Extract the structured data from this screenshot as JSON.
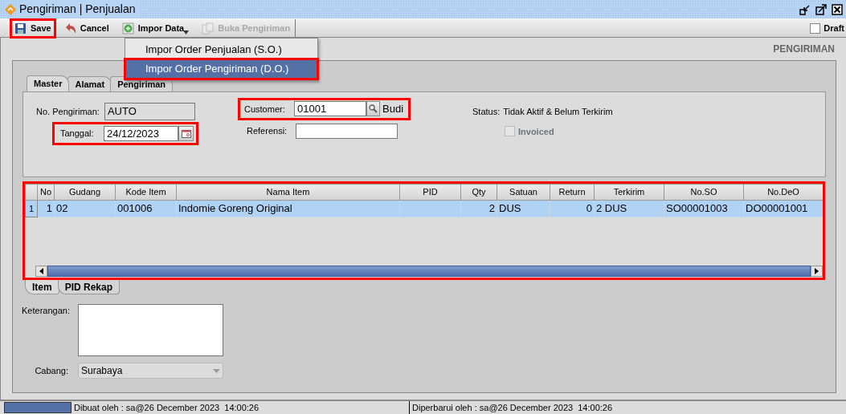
{
  "window": {
    "title": "Pengiriman | Penjualan"
  },
  "toolbar": {
    "buttons": [
      {
        "label": "Save",
        "kind": "save",
        "disabled": false,
        "highlighted": true
      },
      {
        "label": "Cancel",
        "kind": "cancel",
        "disabled": false,
        "highlighted": false
      },
      {
        "label": "Impor Data",
        "kind": "import",
        "disabled": false,
        "highlighted": false
      },
      {
        "label": "Buka Pengiriman",
        "kind": "open",
        "disabled": true,
        "highlighted": false
      }
    ],
    "draft": {
      "label": "Draft",
      "checked": false
    }
  },
  "menu": {
    "items": [
      {
        "label": "Impor Order Penjualan (S.O.)",
        "selected": false,
        "highlighted": false
      },
      {
        "label": "Impor Order Pengiriman (D.O.)",
        "selected": true,
        "highlighted": true
      }
    ]
  },
  "heading": "PENGIRIMAN",
  "tabs": [
    {
      "label": "Master",
      "selected": true
    },
    {
      "label": "Alamat",
      "selected": false
    },
    {
      "label": "Pengiriman",
      "selected": false
    }
  ],
  "master": {
    "no_pengiriman": {
      "label": "No. Pengiriman:",
      "value": "AUTO"
    },
    "tanggal": {
      "label": "Tanggal:",
      "value": "24/12/2023",
      "highlighted": true
    },
    "customer": {
      "label": "Customer:",
      "value": "01001",
      "name": "Budi",
      "highlighted": true
    },
    "referensi": {
      "label": "Referensi:"
    },
    "status": {
      "label": "Status:",
      "value": "Tidak Aktif & Belum Terkirim"
    },
    "invoiced": {
      "label": "Invoiced",
      "checked": false,
      "disabled": true
    }
  },
  "table": {
    "highlighted": true,
    "columns": [
      {
        "label": "No",
        "kind": "number"
      },
      {
        "label": "Gudang",
        "kind": "text"
      },
      {
        "label": "Kode Item",
        "kind": "text"
      },
      {
        "label": "Nama Item",
        "kind": "text"
      },
      {
        "label": "PID",
        "kind": "text"
      },
      {
        "label": "Qty",
        "kind": "number"
      },
      {
        "label": "Satuan",
        "kind": "text"
      },
      {
        "label": "Return",
        "kind": "number"
      },
      {
        "label": "Terkirim",
        "kind": "text"
      },
      {
        "label": "No.SO",
        "kind": "text"
      },
      {
        "label": "No.DeO",
        "kind": "text"
      }
    ],
    "rows": [
      {
        "row_header": "1",
        "selected": true,
        "cells": [
          "1",
          "02",
          "001006",
          "Indomie Goreng Original",
          null,
          "2",
          "DUS",
          "0",
          "2 DUS",
          "SO00001003",
          "DO00001001"
        ]
      }
    ]
  },
  "bottom_tabs": [
    {
      "label": "Item",
      "selected": true
    },
    {
      "label": "PID Rekap",
      "selected": false
    }
  ],
  "keterangan": {
    "label": "Keterangan:"
  },
  "cabang": {
    "label": "Cabang:",
    "value": "Surabaya",
    "disabled": true
  },
  "status_bar": [
    "Dibuat oleh : sa@26 December 2023  14:00:26",
    "Diperbarui oleh : sa@26 December 2023  14:00:26"
  ]
}
